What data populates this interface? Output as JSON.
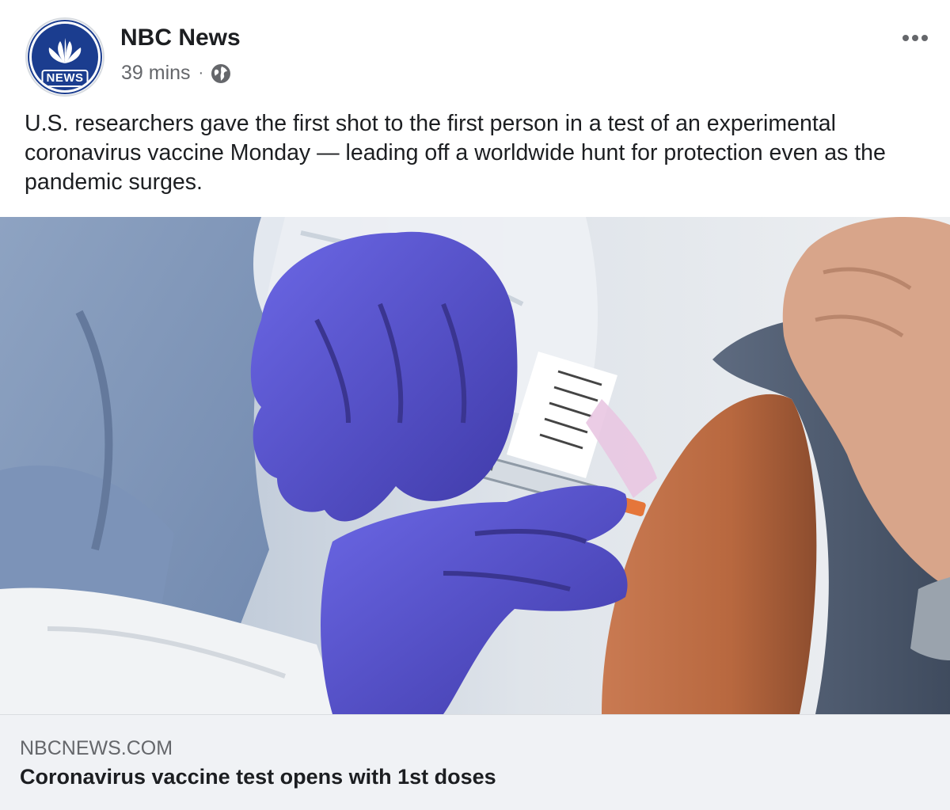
{
  "post": {
    "page_name": "NBC News",
    "avatar_badge": "NEWS",
    "timestamp": "39 mins",
    "separator": "·",
    "privacy_icon": "globe-icon",
    "more_icon": "more-options-icon",
    "text": "U.S. researchers gave the first shot to the first person in a test of an experimental coronavirus vaccine Monday — leading off a worldwide hunt for protection even as the pandemic surges.",
    "link": {
      "domain": "NBCNEWS.COM",
      "title": "Coronavirus vaccine test opens with 1st doses"
    }
  },
  "colors": {
    "avatar_blue": "#1b3d8f",
    "primary_text": "#1c1e21",
    "secondary_text": "#65676b",
    "link_footer_bg": "#f0f2f5",
    "glove_purple": "#5a55d6"
  }
}
